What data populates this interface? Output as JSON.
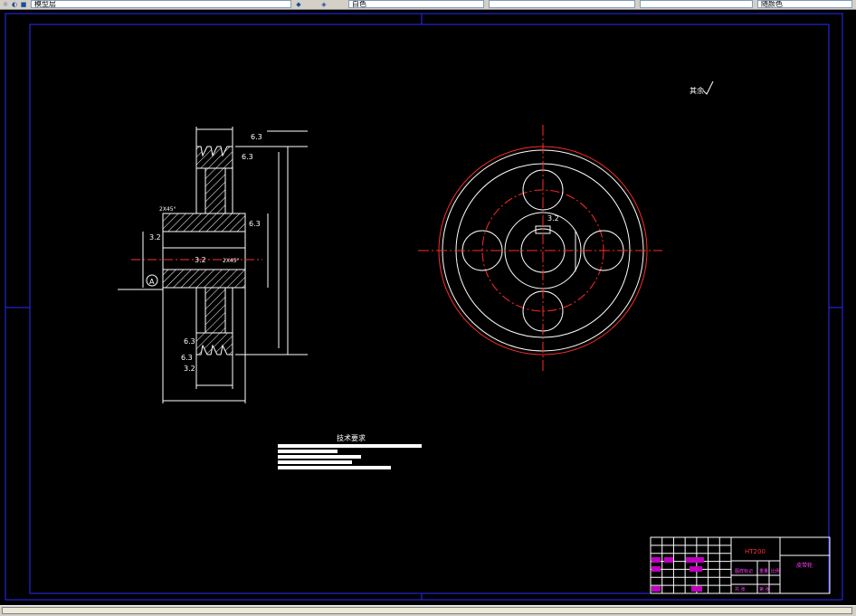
{
  "toolbar": {
    "layer_field": "模型层",
    "color_field": "白色",
    "linetype_field": "",
    "lineweight_field": "",
    "plotstyle_field": "随颜色"
  },
  "drawing": {
    "tech_requirements_title": "技术要求",
    "material": "HT200",
    "part_name": "皮带轮",
    "surface_finish_note": "其余",
    "section_label": "A",
    "roughness_values": [
      "6.3",
      "6.3",
      "6.3",
      "3.2",
      "3.2",
      "6.3",
      "3.2",
      "6.3",
      "3.2"
    ],
    "chamfer_labels": [
      "2X45°",
      "2X45°"
    ],
    "title_block_labels": {
      "drawing_row": "图样标记",
      "weight": "重量",
      "scale": "比例",
      "sheet_total": "共 张",
      "sheet": "第 张"
    }
  },
  "colors": {
    "background": "#000000",
    "outline": "#ffffff",
    "centerline": "#ff0000",
    "frame": "#0000ff",
    "title_block_text": "#ff00ff",
    "dimension": "#ffffff"
  }
}
